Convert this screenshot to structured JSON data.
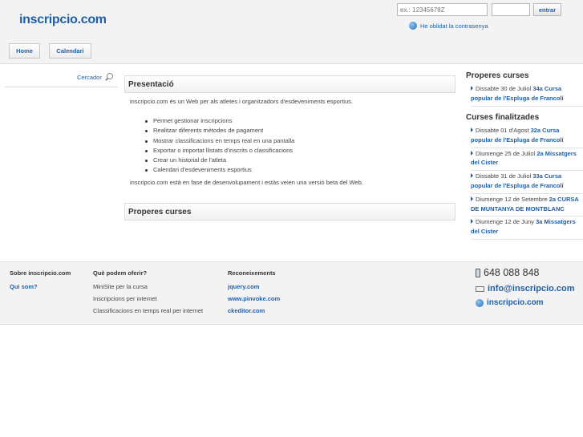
{
  "header": {
    "logo": "inscripcio.com",
    "login": {
      "user_placeholder": "ex.: 12345678Z",
      "password_placeholder": "",
      "submit_label": "entrar",
      "forgot_label": "He oblidat la contrasenya"
    },
    "nav": [
      "Home",
      "Calendari"
    ]
  },
  "search": {
    "label": "Cercador"
  },
  "main": {
    "presentacio_title": "Presentació",
    "intro": "inscripcio.com és un Web per als atletes i organitzadors d'esdeveniments esportius.",
    "features": [
      "Permet gestionar inscripcions",
      "Realitzar diferents mètodes de pagament",
      "Mostrar classificacions en temps real en una pantalla",
      "Exportar o importat llistats d'inscrits o classificacions",
      "Crear un historial de l'atleta",
      "Calendari d'esdeveniments esportius"
    ],
    "beta": "inscripcio.com està en fase de desenvolupament i estàs veien una versió beta del Web.",
    "properes_title": "Properes curses"
  },
  "sidebar": {
    "properes_title": "Properes curses",
    "properes": [
      {
        "date": "Dissabte 30 de Juliol",
        "name": "34a Cursa popular de l'Espluga de Francolí"
      }
    ],
    "finalitzades_title": "Curses finalitzades",
    "finalitzades": [
      {
        "date": "Dissabte 01 d'Agost",
        "name": "32a Cursa popular de l'Espluga de Francolí"
      },
      {
        "date": "Diumenge 25 de Juliol",
        "name": "2a Missatgers del Cister"
      },
      {
        "date": "Dissabte 31 de Juliol",
        "name": "33a Cursa popular de l'Espluga de Francolí"
      },
      {
        "date": "Diumenge 12 de Setembre",
        "name": "2a CURSA DE MUNTANYA DE MONTBLANC"
      },
      {
        "date": "Diumenge 12 de Juny",
        "name": "3a Missatgers del Cister"
      }
    ]
  },
  "footer": {
    "col1": {
      "title": "Sobre inscripcio.com",
      "links": [
        "Qui som?"
      ]
    },
    "col2": {
      "title": "Què podem oferir?",
      "items": [
        "MiniSite per la cursa",
        "Inscripcions per internet",
        "Classificacions en temps real per internet"
      ]
    },
    "col3": {
      "title": "Reconeixements",
      "links": [
        "jquery.com",
        "www.pinvoke.com",
        "ckeditor.com"
      ]
    },
    "contact": {
      "phone": "648 088 848",
      "email": "info@inscripcio.com",
      "web": "inscripcio.com"
    }
  }
}
